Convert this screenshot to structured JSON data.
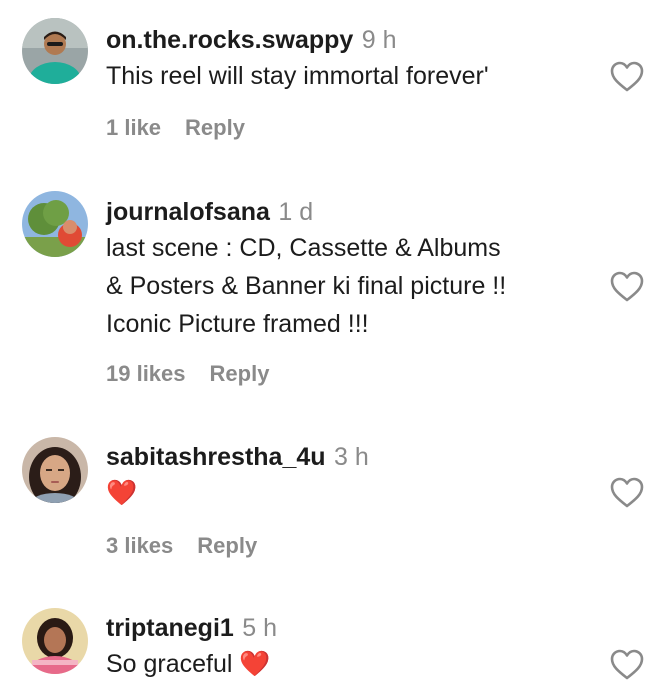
{
  "comments": [
    {
      "username": "on.the.rocks.swappy",
      "time": "9 h",
      "lines": [
        "This reel will stay immortal forever'"
      ],
      "likes": "1 like",
      "reply": "Reply"
    },
    {
      "username": "journalofsana",
      "time": "1 d",
      "lines": [
        "last scene : CD, Cassette & Albums",
        "& Posters & Banner ki final picture !!",
        "Iconic Picture framed !!!"
      ],
      "likes": "19 likes",
      "reply": "Reply"
    },
    {
      "username": "sabitashrestha_4u",
      "time": "3 h",
      "lines": [
        "❤️"
      ],
      "likes": "3 likes",
      "reply": "Reply"
    },
    {
      "username": "triptanegi1",
      "time": "5 h",
      "lines": [
        "So graceful ❤️"
      ]
    }
  ],
  "icons": {
    "like": "heart-outline-icon",
    "emoji": "red-heart-emoji"
  },
  "colors": {
    "text": "#1c1c1c",
    "muted": "#8a8a8a",
    "background": "#ffffff",
    "heart_emoji": "#e8332a"
  }
}
